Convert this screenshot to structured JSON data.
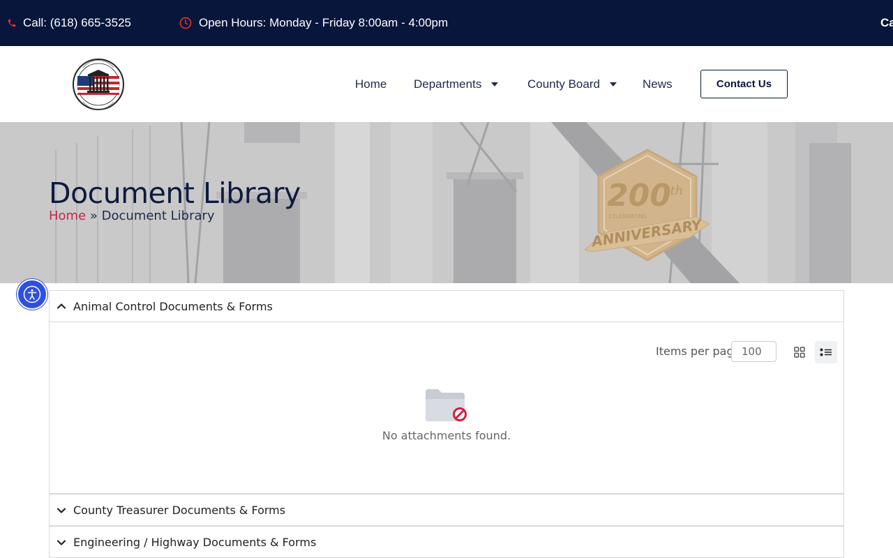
{
  "topbar": {
    "call": "Call: (618) 665-3525",
    "hours": "Open Hours: Monday - Friday 8:00am - 4:00pm",
    "overflow_text": "Ca"
  },
  "header": {
    "nav": {
      "home": "Home",
      "departments": "Departments",
      "county_board": "County Board",
      "news": "News"
    },
    "contact_button": "Contact Us"
  },
  "hero": {
    "title": "Document Library",
    "breadcrumb": {
      "home": "Home",
      "separator": "»",
      "current": "Document Library"
    },
    "badge": {
      "number": "200",
      "suffix": "th",
      "line1": "CELEBRATING",
      "line2": "ANNIVERSARY"
    }
  },
  "accordion": [
    {
      "title": "Animal Control Documents & Forms",
      "expanded": true
    },
    {
      "title": "County Treasurer Documents & Forms",
      "expanded": false
    },
    {
      "title": "Engineering / Highway Documents & Forms",
      "expanded": false
    }
  ],
  "library": {
    "items_per_page_label": "Items per page",
    "items_per_page_value": "100",
    "empty_message": "No attachments found."
  },
  "colors": {
    "topbar_bg": "#08163b",
    "accent_red": "#c8244a",
    "a11y_blue": "#2f4fe0"
  }
}
